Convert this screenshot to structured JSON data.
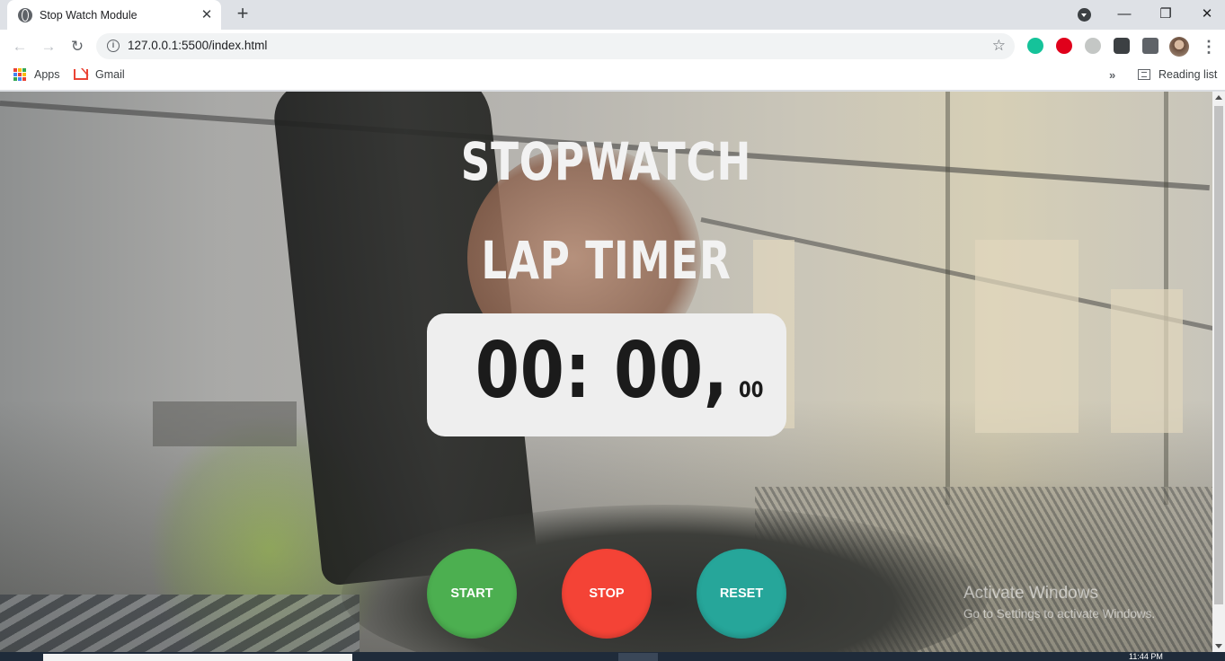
{
  "browser": {
    "tab": {
      "title": "Stop Watch Module",
      "close_glyph": "✕",
      "icon": "globe-icon"
    },
    "new_tab_glyph": "+",
    "window_controls": {
      "minimize": "—",
      "restore": "❐",
      "close": "✕"
    },
    "nav": {
      "back": "←",
      "forward": "→",
      "reload": "↻"
    },
    "address": {
      "url": "127.0.0.1:5500/index.html",
      "info_glyph": "i",
      "bookmark_glyph": "☆"
    },
    "extensions": [
      {
        "name": "grammarly-icon",
        "color": "#15c39a"
      },
      {
        "name": "adblock-icon",
        "color": "#e0001b"
      },
      {
        "name": "globe-extension-icon",
        "color": "#9aa0a6"
      },
      {
        "name": "screen-capture-icon",
        "color": "#3c4043"
      },
      {
        "name": "extensions-puzzle-icon",
        "color": "#5f6368"
      }
    ],
    "menu_glyph": "⋮",
    "bookmarks": [
      {
        "label": "Apps"
      },
      {
        "label": "Gmail"
      }
    ],
    "more_bookmarks_glyph": "»",
    "reading_list": "Reading list"
  },
  "page": {
    "title_line1": "STOPWATCH",
    "title_line2": "LAP TIMER",
    "timer": {
      "main": "00: 00,",
      "ms": "00"
    },
    "buttons": {
      "start": {
        "label": "START",
        "color": "#4caf50"
      },
      "stop": {
        "label": "STOP",
        "color": "#f44336"
      },
      "reset": {
        "label": "RESET",
        "color": "#26a69a"
      }
    }
  },
  "watermark": {
    "line1": "Activate Windows",
    "line2": "Go to Settings to activate Windows."
  },
  "taskbar": {
    "clock": "11:44 PM"
  }
}
